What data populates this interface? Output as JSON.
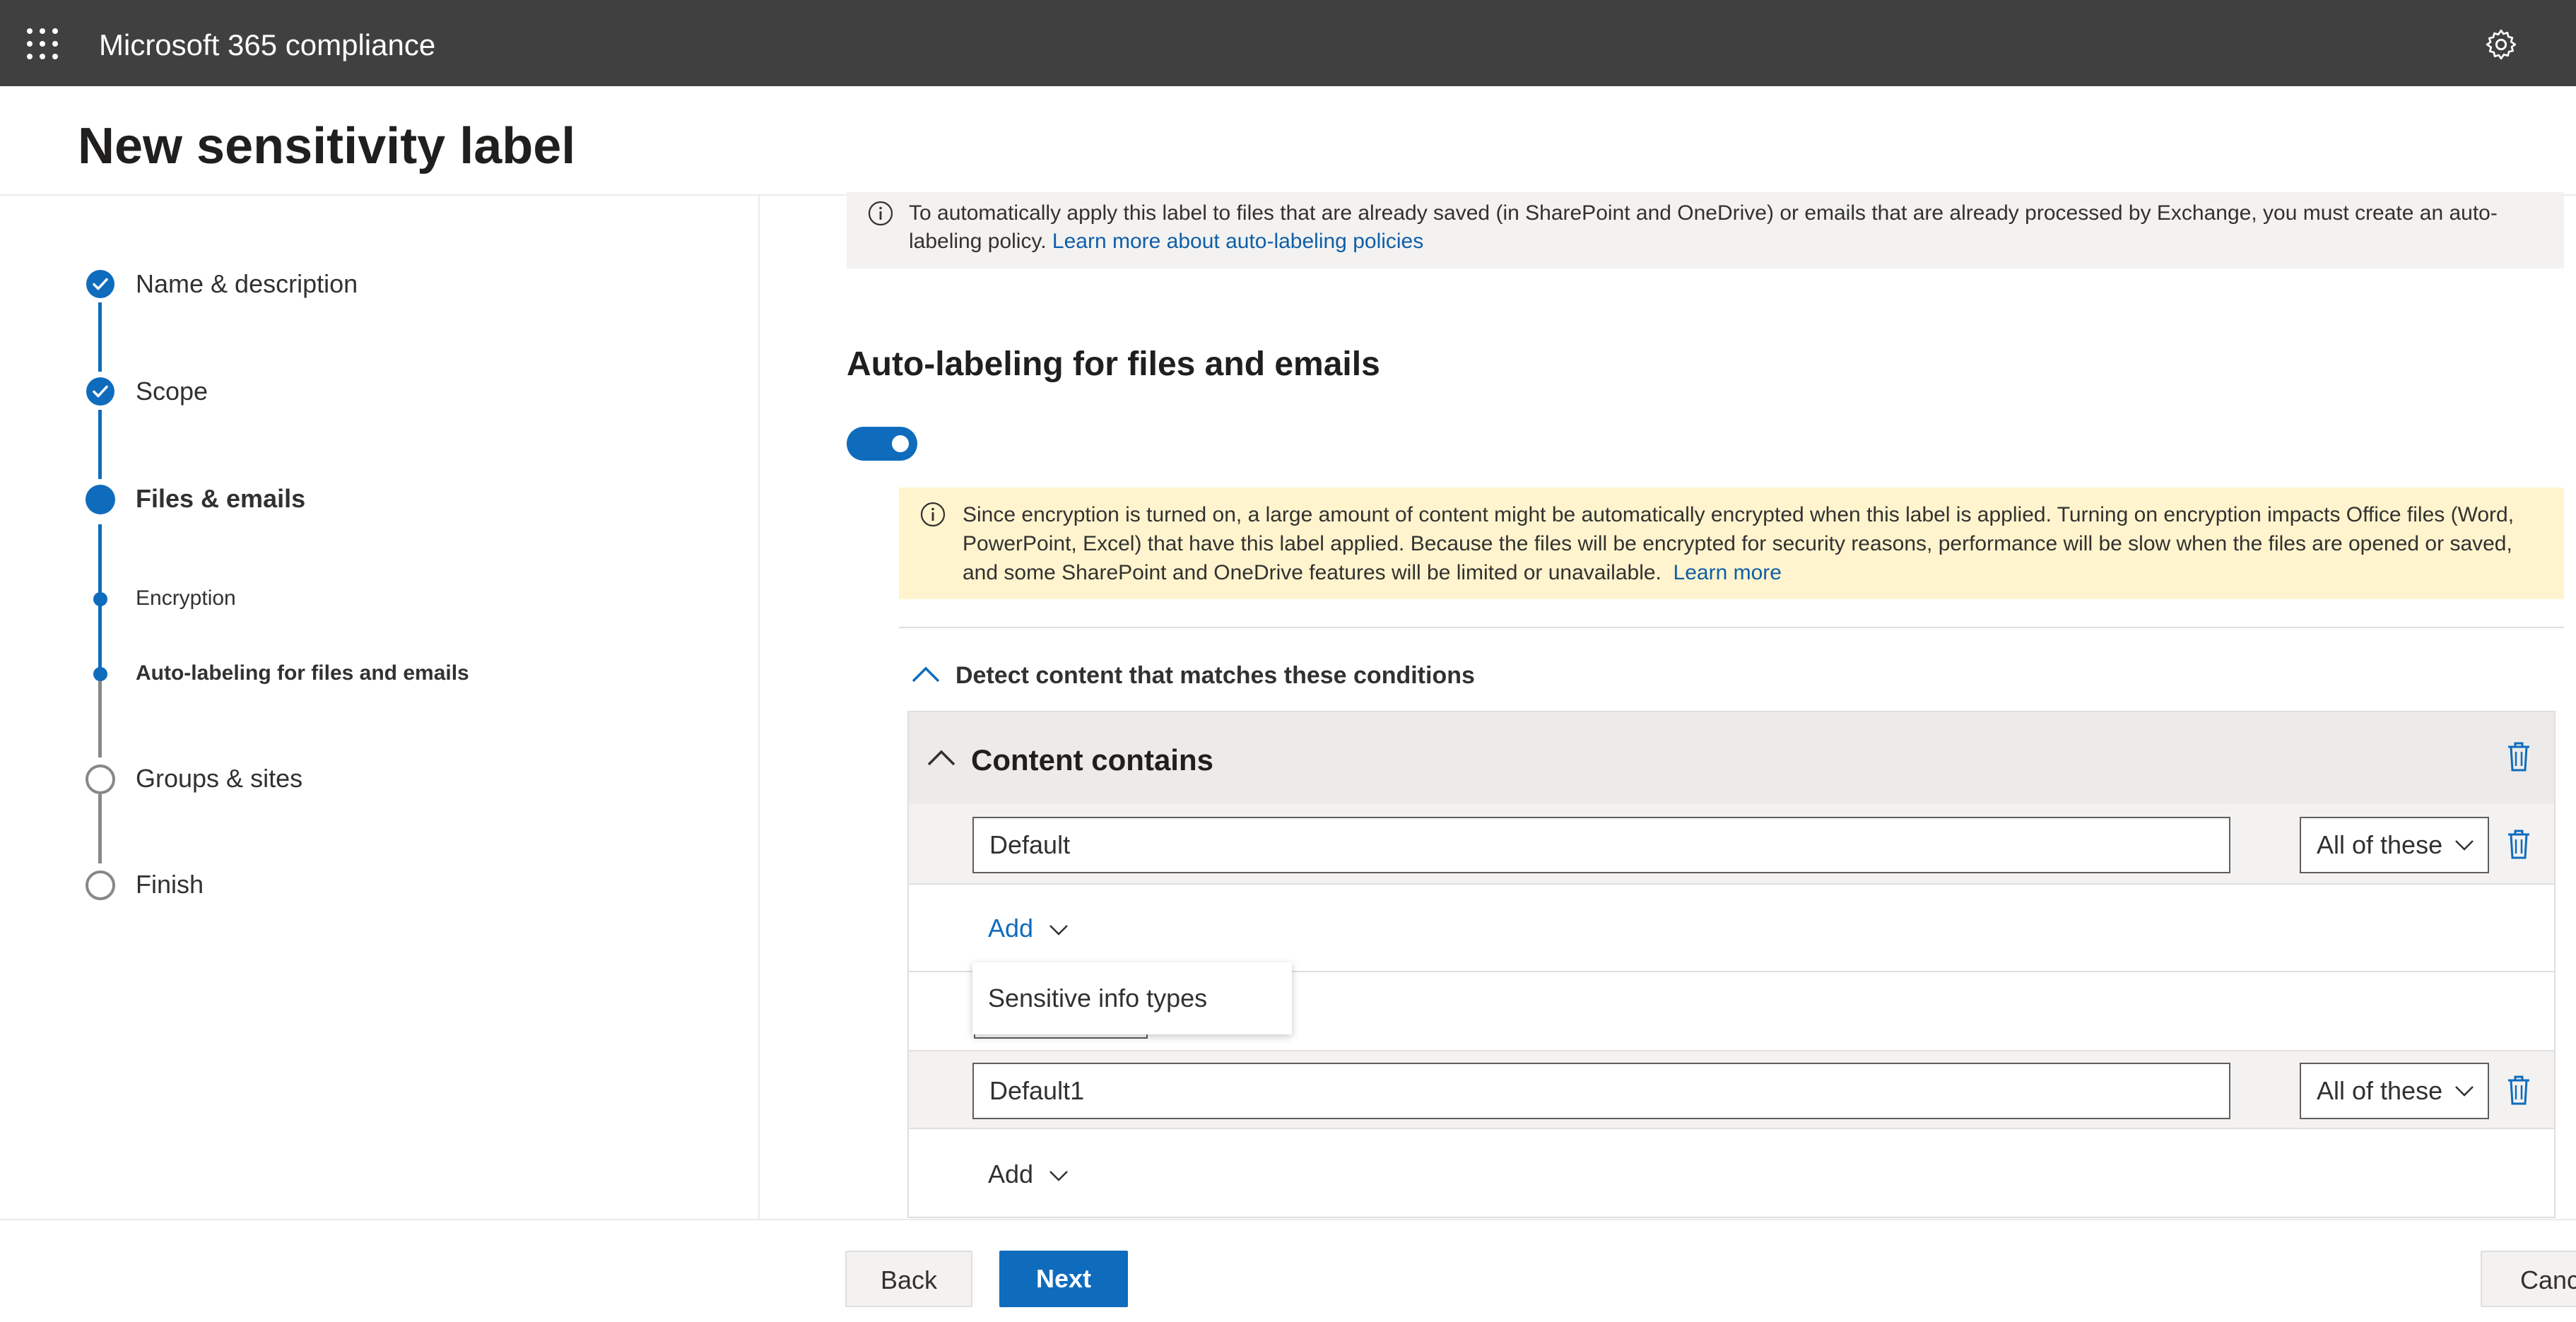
{
  "app": {
    "title": "Microsoft 365 compliance",
    "icons": [
      "app-launcher-icon",
      "settings-gear-icon"
    ]
  },
  "page": {
    "title": "New sensitivity label"
  },
  "stepper": {
    "steps": [
      {
        "label": "Name & description",
        "status": "completed"
      },
      {
        "label": "Scope",
        "status": "completed"
      },
      {
        "label": "Files & emails",
        "status": "current",
        "substeps": [
          {
            "label": "Encryption",
            "status": "visited"
          },
          {
            "label": "Auto-labeling for files and emails",
            "status": "current"
          }
        ]
      },
      {
        "label": "Groups & sites",
        "status": "not-started"
      },
      {
        "label": "Finish",
        "status": "not-started"
      }
    ],
    "colors": {
      "active": "#0f6cbd",
      "inactive": "#8a8886"
    }
  },
  "info": {
    "text": "To automatically apply this label to files that are already saved (in SharePoint and OneDrive) or emails that are already processed by Exchange, you must create an auto-labeling policy.",
    "link": "Learn more about auto-labeling policies"
  },
  "section": {
    "title": "Auto-labeling for files and emails",
    "toggle_on": true
  },
  "warning": {
    "text": "Since encryption is turned on, a large amount of content might be automatically encrypted when this label is applied. Turning on encryption impacts Office files (Word, PowerPoint, Excel) that have this label applied. Because the files will be encrypted for security reasons, performance will be slow when the files are opened or saved, and some SharePoint and OneDrive features will be limited or unavailable.",
    "link": "Learn more",
    "background": "#fff4ce"
  },
  "conditions": {
    "heading": "Detect content that matches these conditions",
    "group_title": "Content contains",
    "groups": [
      {
        "name": "Default",
        "match": "All of these",
        "add_label": "Add"
      },
      {
        "name": "Default1",
        "match": "All of these",
        "add_label": "Add"
      }
    ],
    "add_menu": {
      "items": [
        "Sensitive info types"
      ]
    }
  },
  "footer": {
    "back": "Back",
    "next": "Next",
    "cancel": "Cancel"
  }
}
